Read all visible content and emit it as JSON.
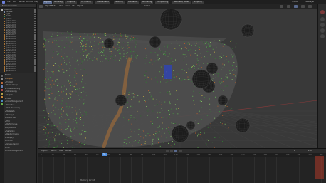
{
  "app": {
    "menu": [
      "File",
      "Edit",
      "Render",
      "Window",
      "Help",
      "Layout",
      "Modeling",
      "Sculpting",
      "UV Editing",
      "Texture Paint",
      "Shading",
      "Animation",
      "Rendering",
      "Compositing",
      "Geometry Nodes",
      "Scripting"
    ],
    "active_tab": "Layout",
    "scene_label": "Scene",
    "view_layer_label": "ViewLayer"
  },
  "outliner": {
    "header": "Scene Collection",
    "rows": [
      "Collection",
      "Camera",
      "Light",
      "Points",
      "Sphere",
      "Sphere.001",
      "Sphere.002",
      "Sphere.003",
      "Sphere.004",
      "Sphere.005",
      "Sphere.006",
      "Sphere.007",
      "Sphere.008",
      "Sphere.009",
      "Sphere.010",
      "Sphere.011",
      "Sphere.012",
      "Sphere.013",
      "Sphere.014",
      "Sphere.015",
      "Sphere.016",
      "Sphere.017",
      "Sphere.018",
      "Sphere.019",
      "Sphere.020",
      "Sphere.021",
      "Sphere.022",
      "Sphere.023"
    ],
    "row_colors": [
      "#e0e0e0",
      "#8fa3c8",
      "#e0c070",
      "#3fae5a",
      "#d08a3a",
      "#d08a3a",
      "#d08a3a",
      "#d08a3a",
      "#d08a3a",
      "#d08a3a",
      "#d08a3a",
      "#d08a3a",
      "#d08a3a",
      "#d08a3a",
      "#d08a3a",
      "#d08a3a",
      "#d08a3a",
      "#d08a3a",
      "#d08a3a",
      "#d08a3a",
      "#d08a3a",
      "#d08a3a",
      "#d08a3a",
      "#d08a3a",
      "#d08a3a",
      "#d08a3a",
      "#d08a3a",
      "#d08a3a"
    ]
  },
  "properties": {
    "object_name": "Points",
    "rows": [
      "Output",
      "Format",
      "Frame Range",
      "Time Stretching",
      "Stereoscopy",
      "Output",
      "Views",
      "Color Management",
      "Encoding",
      "Post Processing",
      "Metadata",
      "Freestyle",
      "Motion Blur",
      "Film",
      "Performance",
      "Light Paths",
      "Sampling",
      "Render Engine",
      "Simplify",
      "Curves",
      "Grease Pencil",
      "Hair",
      "Color Management"
    ],
    "highlight_row": 0
  },
  "viewport": {
    "mode": "Object Mode",
    "view_menu": [
      "View",
      "Select",
      "Add",
      "Object"
    ],
    "shading": "Global"
  },
  "timeline": {
    "menu": [
      "Playback",
      "Keying",
      "View",
      "Marker"
    ],
    "ticks": [
      "0",
      "10",
      "20",
      "30",
      "40",
      "50",
      "60",
      "70",
      "80",
      "90",
      "100",
      "110",
      "120",
      "130",
      "140",
      "150",
      "160",
      "170",
      "180",
      "190",
      "200",
      "210",
      "220",
      "230",
      "240",
      "250"
    ],
    "current_frame": "56",
    "start": "1",
    "end": "250",
    "status": "Memory: 1.2 GiB"
  }
}
